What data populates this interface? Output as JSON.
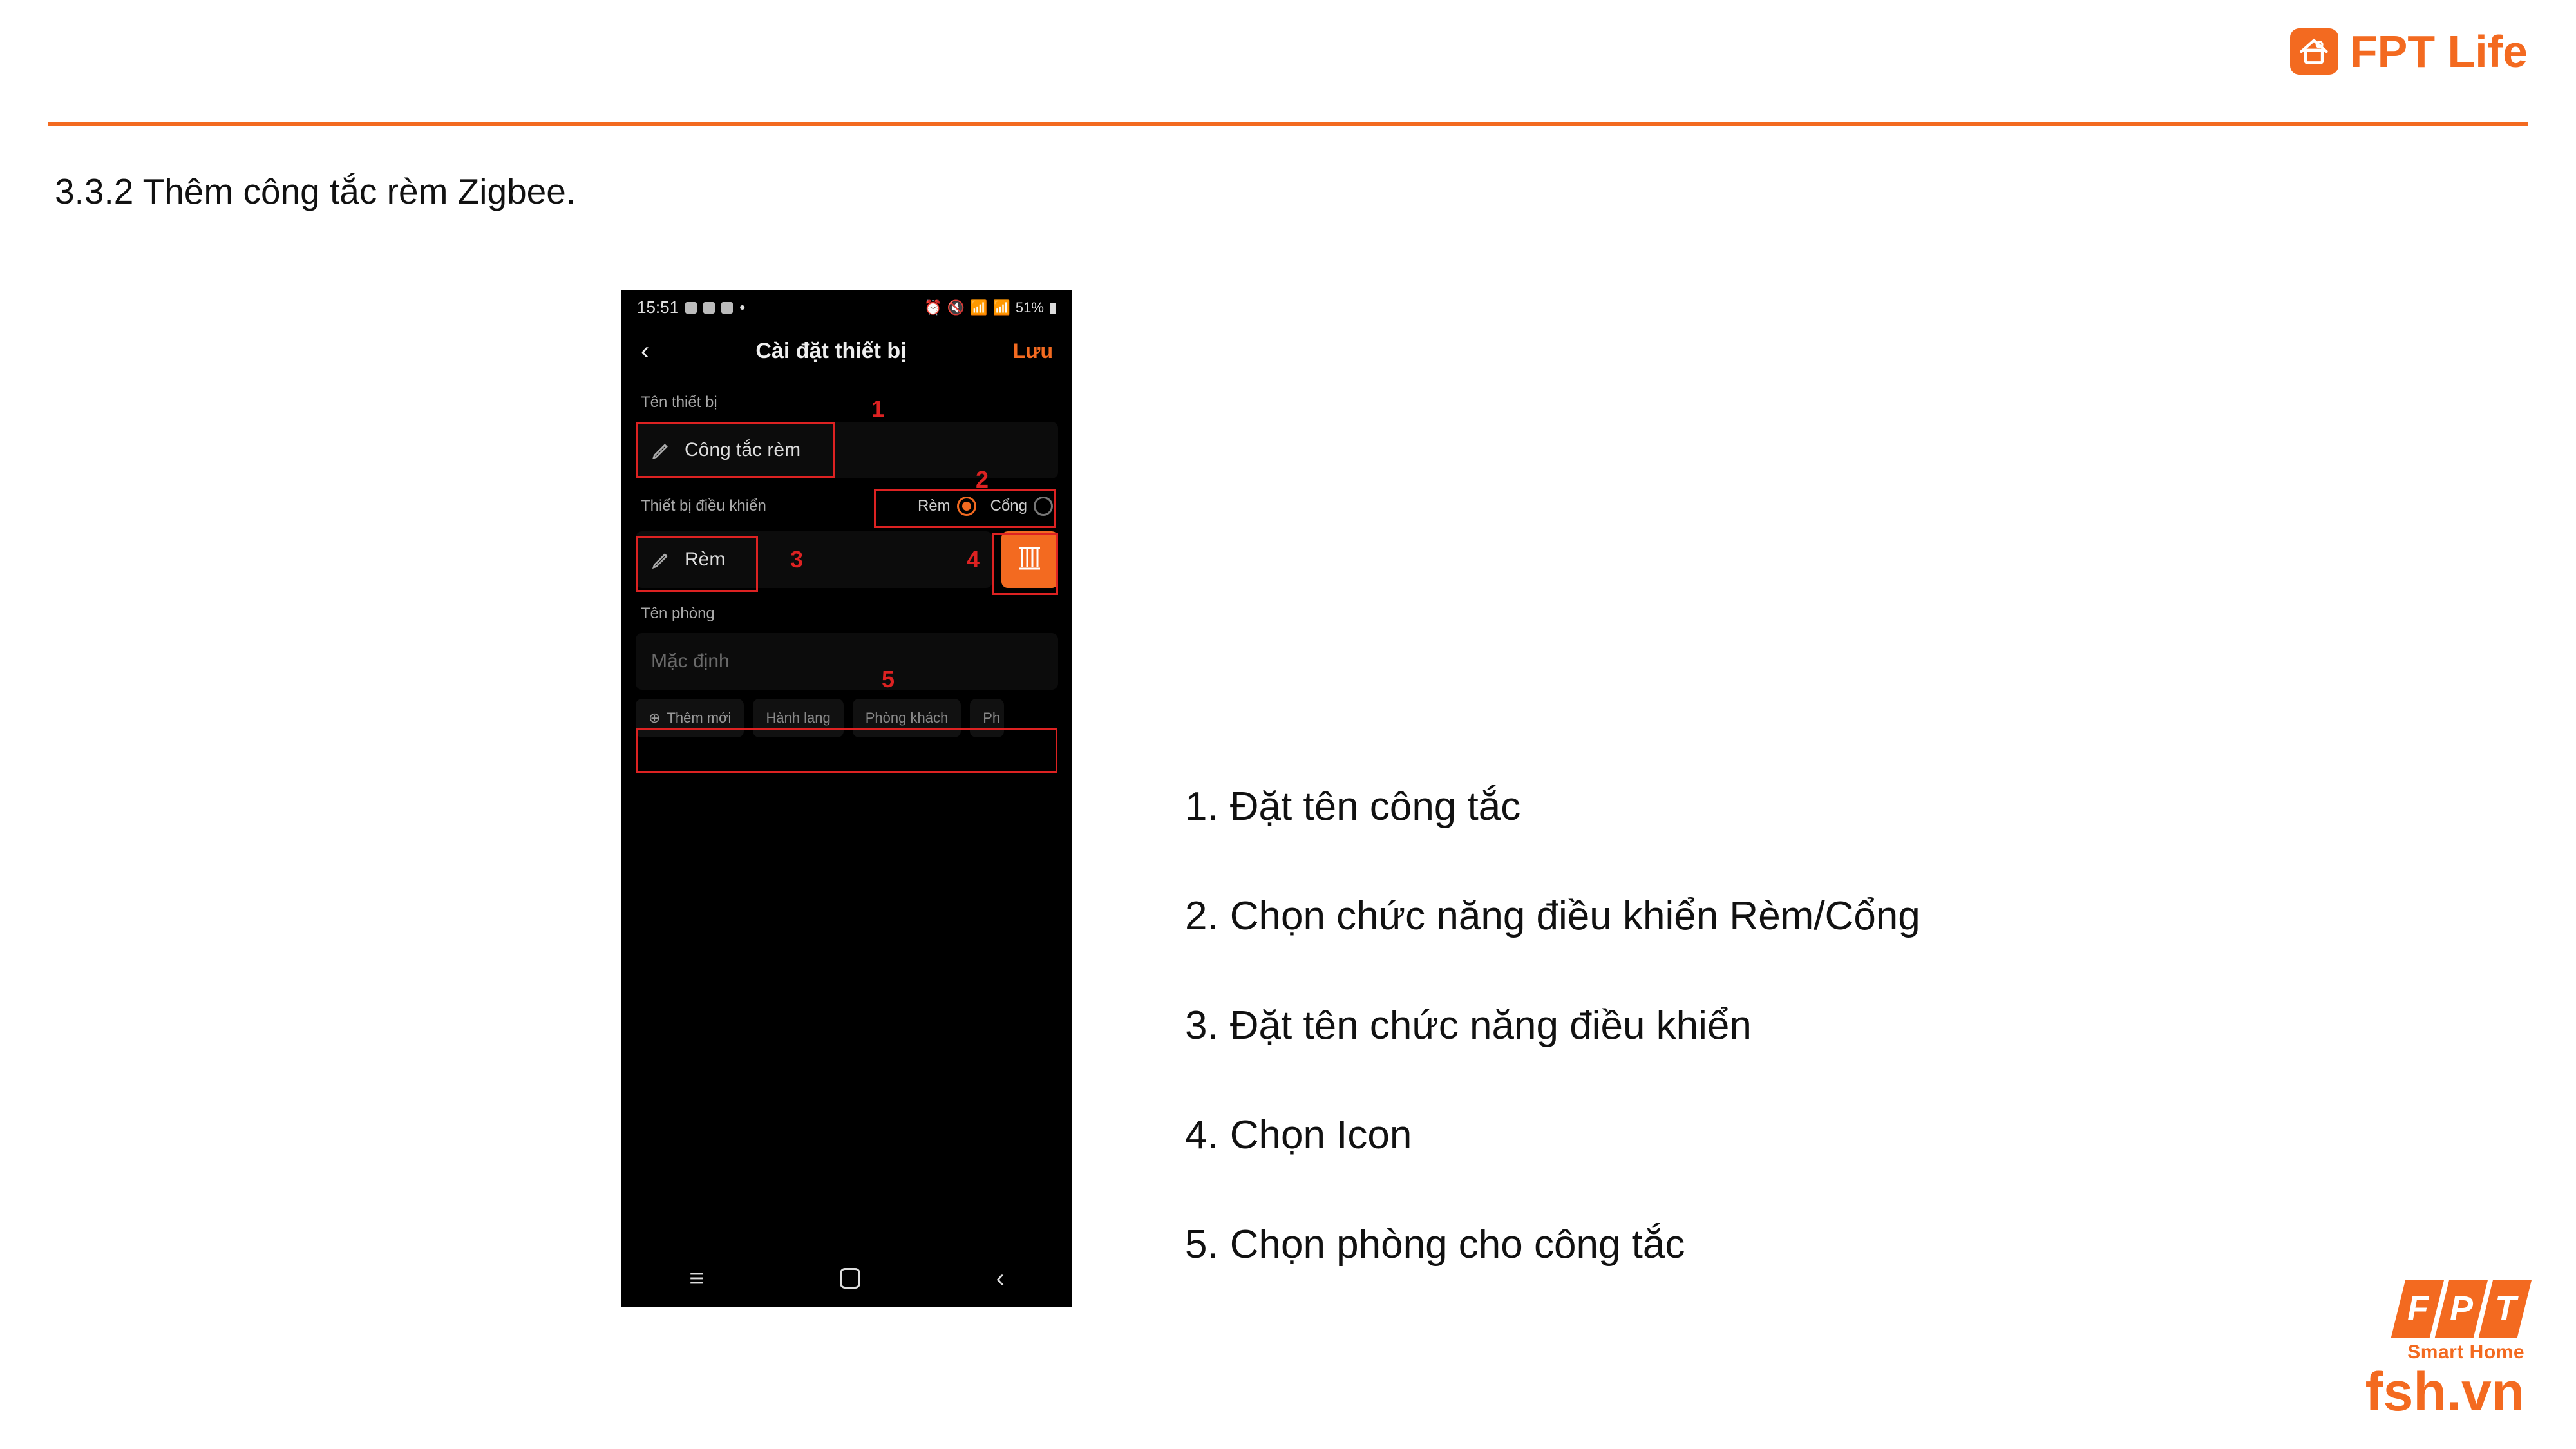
{
  "brand_top": {
    "label": "FPT Life"
  },
  "section_title": "3.3.2 Thêm công tắc rèm Zigbee.",
  "phone": {
    "status": {
      "time": "15:51",
      "battery": "51%"
    },
    "titlebar": {
      "title": "Cài đặt thiết bị",
      "save": "Lưu"
    },
    "device_name": {
      "label": "Tên thiết bị",
      "value": "Công tắc rèm"
    },
    "control": {
      "label": "Thiết bị điều khiển",
      "opt1": "Rèm",
      "opt2": "Cổng",
      "name_value": "Rèm"
    },
    "room": {
      "label": "Tên phòng",
      "placeholder": "Mặc định",
      "chips": {
        "add": "Thêm mới",
        "c1": "Hành lang",
        "c2": "Phòng khách",
        "c3": "Ph"
      }
    },
    "annot": {
      "n1": "1",
      "n2": "2",
      "n3": "3",
      "n4": "4",
      "n5": "5"
    }
  },
  "steps": {
    "s1": {
      "n": "1.",
      "t": "Đặt tên công tắc"
    },
    "s2": {
      "n": "2.",
      "t": "Chọn chức năng điều khiển Rèm/Cổng"
    },
    "s3": {
      "n": "3.",
      "t": "Đặt tên chức năng điều khiển"
    },
    "s4": {
      "n": "4.",
      "t": "Chọn Icon"
    },
    "s5": {
      "n": "5.",
      "t": "Chọn phòng cho công tắc"
    }
  },
  "brand_bottom": {
    "f": "F",
    "p": "P",
    "t": "T",
    "smart": "Smart Home",
    "site": "fsh.vn"
  }
}
